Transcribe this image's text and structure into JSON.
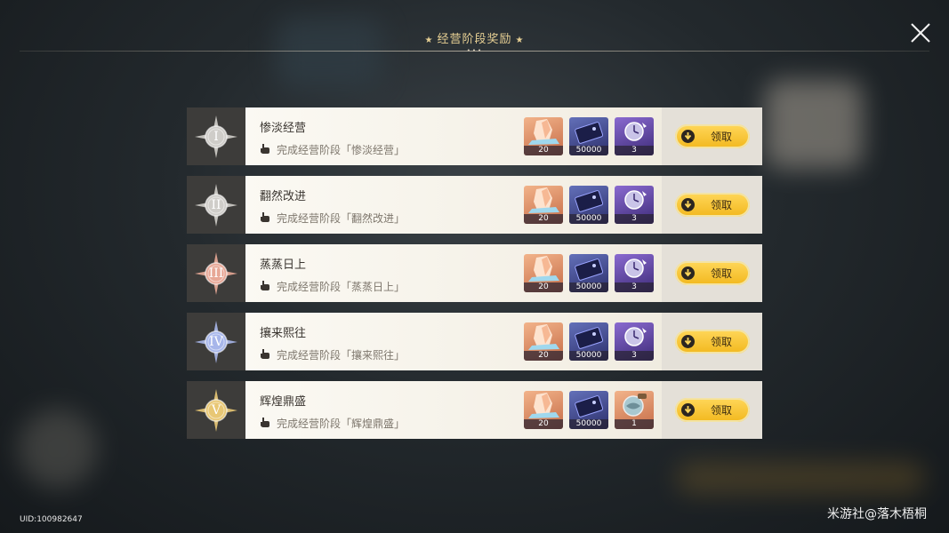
{
  "header": {
    "title": "经营阶段奖励",
    "star_left": "★",
    "star_right": "★",
    "dots": "•••"
  },
  "close_icon": "close-icon",
  "stages": [
    {
      "numeral": "I",
      "numeral_color": "#cfcdc9",
      "name": "惨淡经营",
      "condition": "完成经营阶段「惨淡经营」",
      "rewards": [
        {
          "icon": "crystal-icon",
          "qty": "20"
        },
        {
          "icon": "ticket-icon",
          "qty": "50000"
        },
        {
          "icon": "clock-material-icon",
          "qty": "3"
        }
      ],
      "claim_label": "领取"
    },
    {
      "numeral": "II",
      "numeral_color": "#cfcdc9",
      "name": "翻然改进",
      "condition": "完成经营阶段「翻然改进」",
      "rewards": [
        {
          "icon": "crystal-icon",
          "qty": "20"
        },
        {
          "icon": "ticket-icon",
          "qty": "50000"
        },
        {
          "icon": "clock-material-icon",
          "qty": "3"
        }
      ],
      "claim_label": "领取"
    },
    {
      "numeral": "III",
      "numeral_color": "#e7a796",
      "name": "蒸蒸日上",
      "condition": "完成经营阶段「蒸蒸日上」",
      "rewards": [
        {
          "icon": "crystal-icon",
          "qty": "20"
        },
        {
          "icon": "ticket-icon",
          "qty": "50000"
        },
        {
          "icon": "clock-material-icon",
          "qty": "3"
        }
      ],
      "claim_label": "领取"
    },
    {
      "numeral": "IV",
      "numeral_color": "#a7b6ea",
      "name": "攘来熙往",
      "condition": "完成经营阶段「攘来熙往」",
      "rewards": [
        {
          "icon": "crystal-icon",
          "qty": "20"
        },
        {
          "icon": "ticket-icon",
          "qty": "50000"
        },
        {
          "icon": "clock-material-icon",
          "qty": "3"
        }
      ],
      "claim_label": "领取"
    },
    {
      "numeral": "V",
      "numeral_color": "#e8c774",
      "name": "辉煌鼎盛",
      "condition": "完成经营阶段「辉煌鼎盛」",
      "rewards": [
        {
          "icon": "crystal-icon",
          "qty": "20"
        },
        {
          "icon": "ticket-icon",
          "qty": "50000"
        },
        {
          "icon": "globe-item-icon",
          "qty": "1"
        }
      ],
      "claim_label": "领取"
    }
  ],
  "footer": {
    "uid": "UID:100982647",
    "watermark": "米游社@落木梧桐"
  }
}
